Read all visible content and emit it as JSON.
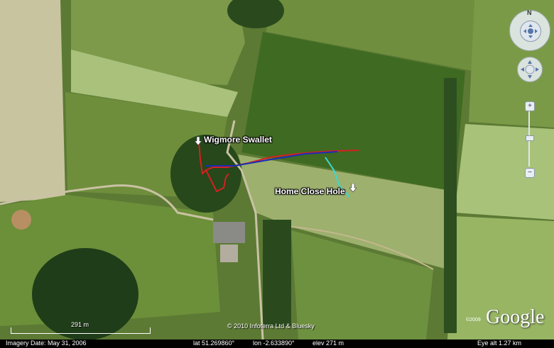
{
  "placemarks": [
    {
      "name": "Wigmore Swallet"
    },
    {
      "name": "Home Close Hole"
    }
  ],
  "copyright": "© 2010 Infoterra Ltd & Bluesky",
  "scale": {
    "label": "291 m"
  },
  "logo": {
    "text": "Google",
    "year": "©2009"
  },
  "compass": {
    "north": "N"
  },
  "status": {
    "imagery_date": "Imagery Date: May 31, 2006",
    "lat": "lat  51.269860°",
    "lon": "lon  -2.633890°",
    "elev": "elev  271 m",
    "eye_alt": "Eye alt   1.27 km"
  },
  "colors": {
    "cave_survey_red": "#d62020",
    "cave_survey_blue": "#1a2db5",
    "cave_survey_cyan": "#3cd8d0"
  }
}
